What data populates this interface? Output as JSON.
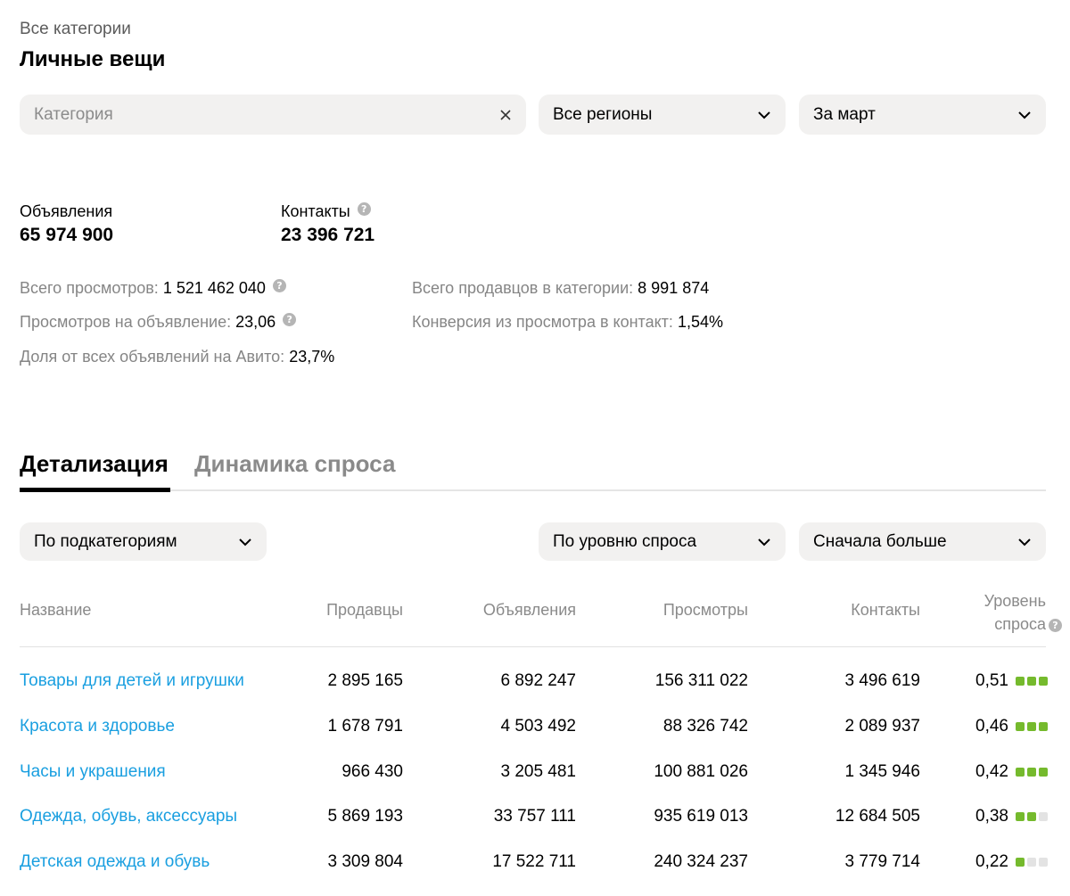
{
  "breadcrumb": "Все категории",
  "title": "Личные вещи",
  "filters": {
    "category": {
      "placeholder": "Категория",
      "value": ""
    },
    "region": "Все регионы",
    "period": "За март"
  },
  "summary": {
    "ads_label": "Объявления",
    "ads_value": "65 974 900",
    "contacts_label": "Контакты",
    "contacts_value": "23 396 721"
  },
  "metrics": {
    "views_label": "Всего просмотров:",
    "views_value": "1 521 462 040",
    "views_per_ad_label": "Просмотров на объявление:",
    "views_per_ad_value": "23,06",
    "share_label": "Доля от всех объявлений на Авито:",
    "share_value": "23,7%",
    "sellers_label": "Всего продавцов в категории:",
    "sellers_value": "8 991 874",
    "conversion_label": "Конверсия из просмотра в контакт:",
    "conversion_value": "1,54%"
  },
  "tabs": [
    {
      "label": "Детализация",
      "active": true
    },
    {
      "label": "Динамика спроса",
      "active": false
    }
  ],
  "table_controls": {
    "grouping": "По подкатегориям",
    "sort_by": "По уровню спроса",
    "order": "Сначала больше"
  },
  "table": {
    "headers": {
      "name": "Название",
      "sellers": "Продавцы",
      "ads": "Объявления",
      "views": "Просмотры",
      "contacts": "Контакты",
      "demand_line1": "Уровень",
      "demand_line2": "спроса"
    },
    "rows": [
      {
        "name": "Товары для детей и игрушки",
        "sellers": "2 895 165",
        "ads": "6 892 247",
        "views": "156 311 022",
        "contacts": "3 496 619",
        "demand": "0,51",
        "level": 3
      },
      {
        "name": "Красота и здоровье",
        "sellers": "1 678 791",
        "ads": "4 503 492",
        "views": "88 326 742",
        "contacts": "2 089 937",
        "demand": "0,46",
        "level": 3
      },
      {
        "name": "Часы и украшения",
        "sellers": "966 430",
        "ads": "3 205 481",
        "views": "100 881 026",
        "contacts": "1 345 946",
        "demand": "0,42",
        "level": 3
      },
      {
        "name": "Одежда, обувь, аксессуары",
        "sellers": "5 869 193",
        "ads": "33 757 111",
        "views": "935 619 013",
        "contacts": "12 684 505",
        "demand": "0,38",
        "level": 2
      },
      {
        "name": "Детская одежда и обувь",
        "sellers": "3 309 804",
        "ads": "17 522 711",
        "views": "240 324 237",
        "contacts": "3 779 714",
        "demand": "0,22",
        "level": 1
      }
    ]
  },
  "colors": {
    "link": "#1a9fe0",
    "dot_on": "#75ba2d",
    "dot_off": "#e3e3e3"
  }
}
